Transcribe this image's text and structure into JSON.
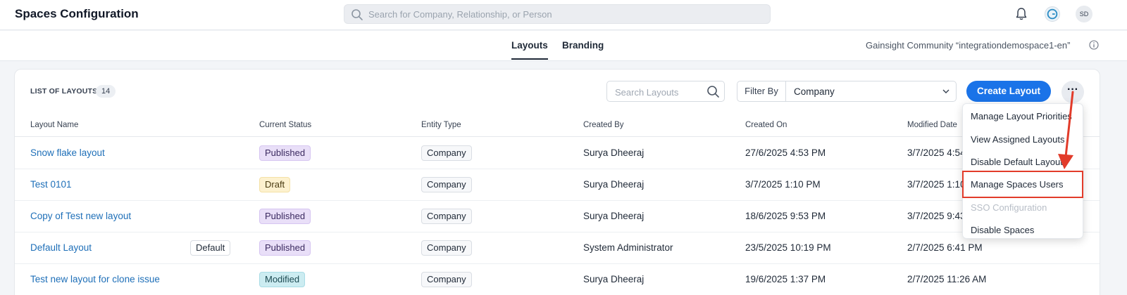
{
  "header": {
    "title": "Spaces Configuration",
    "search_placeholder": "Search for Company, Relationship, or Person",
    "user_initials": "SD",
    "icons": [
      "search-icon",
      "bell-icon",
      "gainsight-logo-icon"
    ]
  },
  "subheader": {
    "tabs": [
      {
        "label": "Layouts",
        "active": true
      },
      {
        "label": "Branding",
        "active": false
      }
    ],
    "community": "Gainsight Community “integrationdemospace1-en”"
  },
  "toolbar": {
    "list_title": "LIST OF LAYOUTS",
    "count": "14",
    "search_placeholder": "Search Layouts",
    "filter_label": "Filter By",
    "filter_value": "Company",
    "create_label": "Create Layout",
    "more_label": "···"
  },
  "table": {
    "columns": [
      "Layout Name",
      "Current Status",
      "Entity Type",
      "Created By",
      "Created On",
      "Modified Date"
    ],
    "rows": [
      {
        "name": "Snow flake layout",
        "default": "",
        "status": "Published",
        "entity": "Company",
        "created_by": "Surya Dheeraj",
        "created_on": "27/6/2025 4:53 PM",
        "modified": "3/7/2025 4:54"
      },
      {
        "name": "Test 0101",
        "default": "",
        "status": "Draft",
        "entity": "Company",
        "created_by": "Surya Dheeraj",
        "created_on": "3/7/2025 1:10 PM",
        "modified": "3/7/2025 1:10"
      },
      {
        "name": "Copy of Test new layout",
        "default": "",
        "status": "Published",
        "entity": "Company",
        "created_by": "Surya Dheeraj",
        "created_on": "18/6/2025 9:53 PM",
        "modified": "3/7/2025 9:43"
      },
      {
        "name": "Default Layout",
        "default": "Default",
        "status": "Published",
        "entity": "Company",
        "created_by": "System Administrator",
        "created_on": "23/5/2025 10:19 PM",
        "modified": "2/7/2025 6:41 PM"
      },
      {
        "name": "Test new layout for clone issue",
        "default": "",
        "status": "Modified",
        "entity": "Company",
        "created_by": "Surya Dheeraj",
        "created_on": "19/6/2025 1:37 PM",
        "modified": "2/7/2025 11:26 AM"
      }
    ]
  },
  "menu": {
    "items": [
      {
        "label": "Manage Layout Priorities",
        "disabled": false
      },
      {
        "label": "View Assigned Layouts",
        "disabled": false
      },
      {
        "label": "Disable Default Layouts",
        "disabled": false
      },
      {
        "label": "Manage Spaces Users",
        "disabled": false,
        "highlighted": true
      },
      {
        "label": "SSO Configuration",
        "disabled": true
      },
      {
        "label": "Disable Spaces",
        "disabled": false
      }
    ]
  },
  "colors": {
    "accent": "#1a73e8",
    "annotation": "#e23b2a",
    "published": "#e9dff8",
    "draft": "#fdf1cf",
    "modified": "#ccecf1"
  }
}
